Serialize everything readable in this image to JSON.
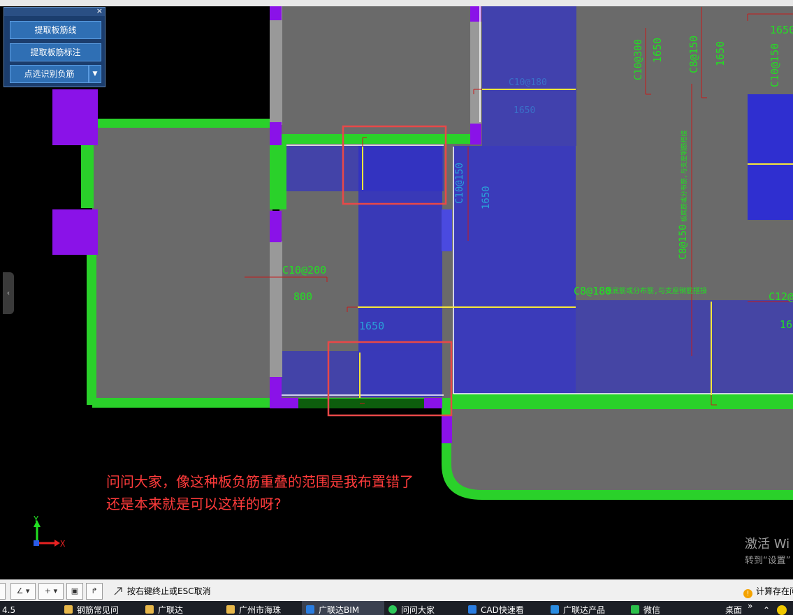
{
  "panel": {
    "close_label": "×",
    "buttons": [
      "提取板筋线",
      "提取板筋标注",
      "点选识别负筋"
    ],
    "dropdown_arrow": "▼"
  },
  "drawing": {
    "labels": {
      "c10_200": "C10@200",
      "dim_800": "800",
      "dim_1650_a": "1650",
      "dim_1650_mid": "1650",
      "dim_1650_b": "1650",
      "dim_1650_c": "1650",
      "dim_1650_d": "1650",
      "c10_150_a": "C10@150",
      "c10_150_b": "C10@150",
      "c10_300": "C10@300",
      "c8_150_top": "C8@150",
      "c8_150_long": "C8@150",
      "long_note": "板底筋或分布筋,与支座钢筋搭接",
      "c8_180": "C8@180",
      "c8_180_note": "板底筋或分布筋,与支座钢筋搭接",
      "c12_label": "C12@",
      "c10_180_faint": "C10@180",
      "dim_1650_faint": "1650",
      "dim_1650_faint2": "1650",
      "axis_y": "Y",
      "axis_x": "X"
    },
    "colors": {
      "background": "#000000",
      "slab": "#6a6a6a",
      "wall": "#2ad12a",
      "column": "#8a12e8",
      "rebar_zone": "#3333cc",
      "highlight_box": "#e84848",
      "rebar_line": "#f7e73a",
      "annotation": "#22e022"
    }
  },
  "question": {
    "line1": "问问大家，像这种板负筋重叠的范围是我布置错了",
    "line2": "还是本来就是可以这样的呀?"
  },
  "watermark": {
    "line1": "激活 Wi",
    "line2": "转到“设置”"
  },
  "collapse_label": "‹",
  "statusbar": {
    "tools": [
      "∠",
      "+",
      "▣",
      "↱"
    ],
    "dropdown_arrow": "▾",
    "message": "按右键终止或ESC取消",
    "right_text": "计算存在问",
    "warn_icon": "!"
  },
  "taskbar": {
    "left_text": "4.5",
    "items": [
      {
        "label": "钢筋常见问",
        "icon": "folder-icon",
        "color": "#e8b84a"
      },
      {
        "label": "广联达",
        "icon": "folder-icon",
        "color": "#e8b84a"
      },
      {
        "label": "广州市海珠",
        "icon": "folder-icon",
        "color": "#e8b84a"
      },
      {
        "label": "广联达BIM",
        "icon": "app-icon",
        "color": "#2a7de1"
      },
      {
        "label": "问问大家",
        "icon": "app-icon",
        "color": "#2fc95a"
      },
      {
        "label": "CAD快速看",
        "icon": "app-icon",
        "color": "#2a7de1"
      },
      {
        "label": "广联达产品",
        "icon": "app-icon",
        "color": "#2a8ce1"
      },
      {
        "label": "微信",
        "icon": "app-icon",
        "color": "#2bbf4a"
      }
    ],
    "desktop_label": "桌面",
    "more_label": "»",
    "tray_glyph": "⌃"
  }
}
